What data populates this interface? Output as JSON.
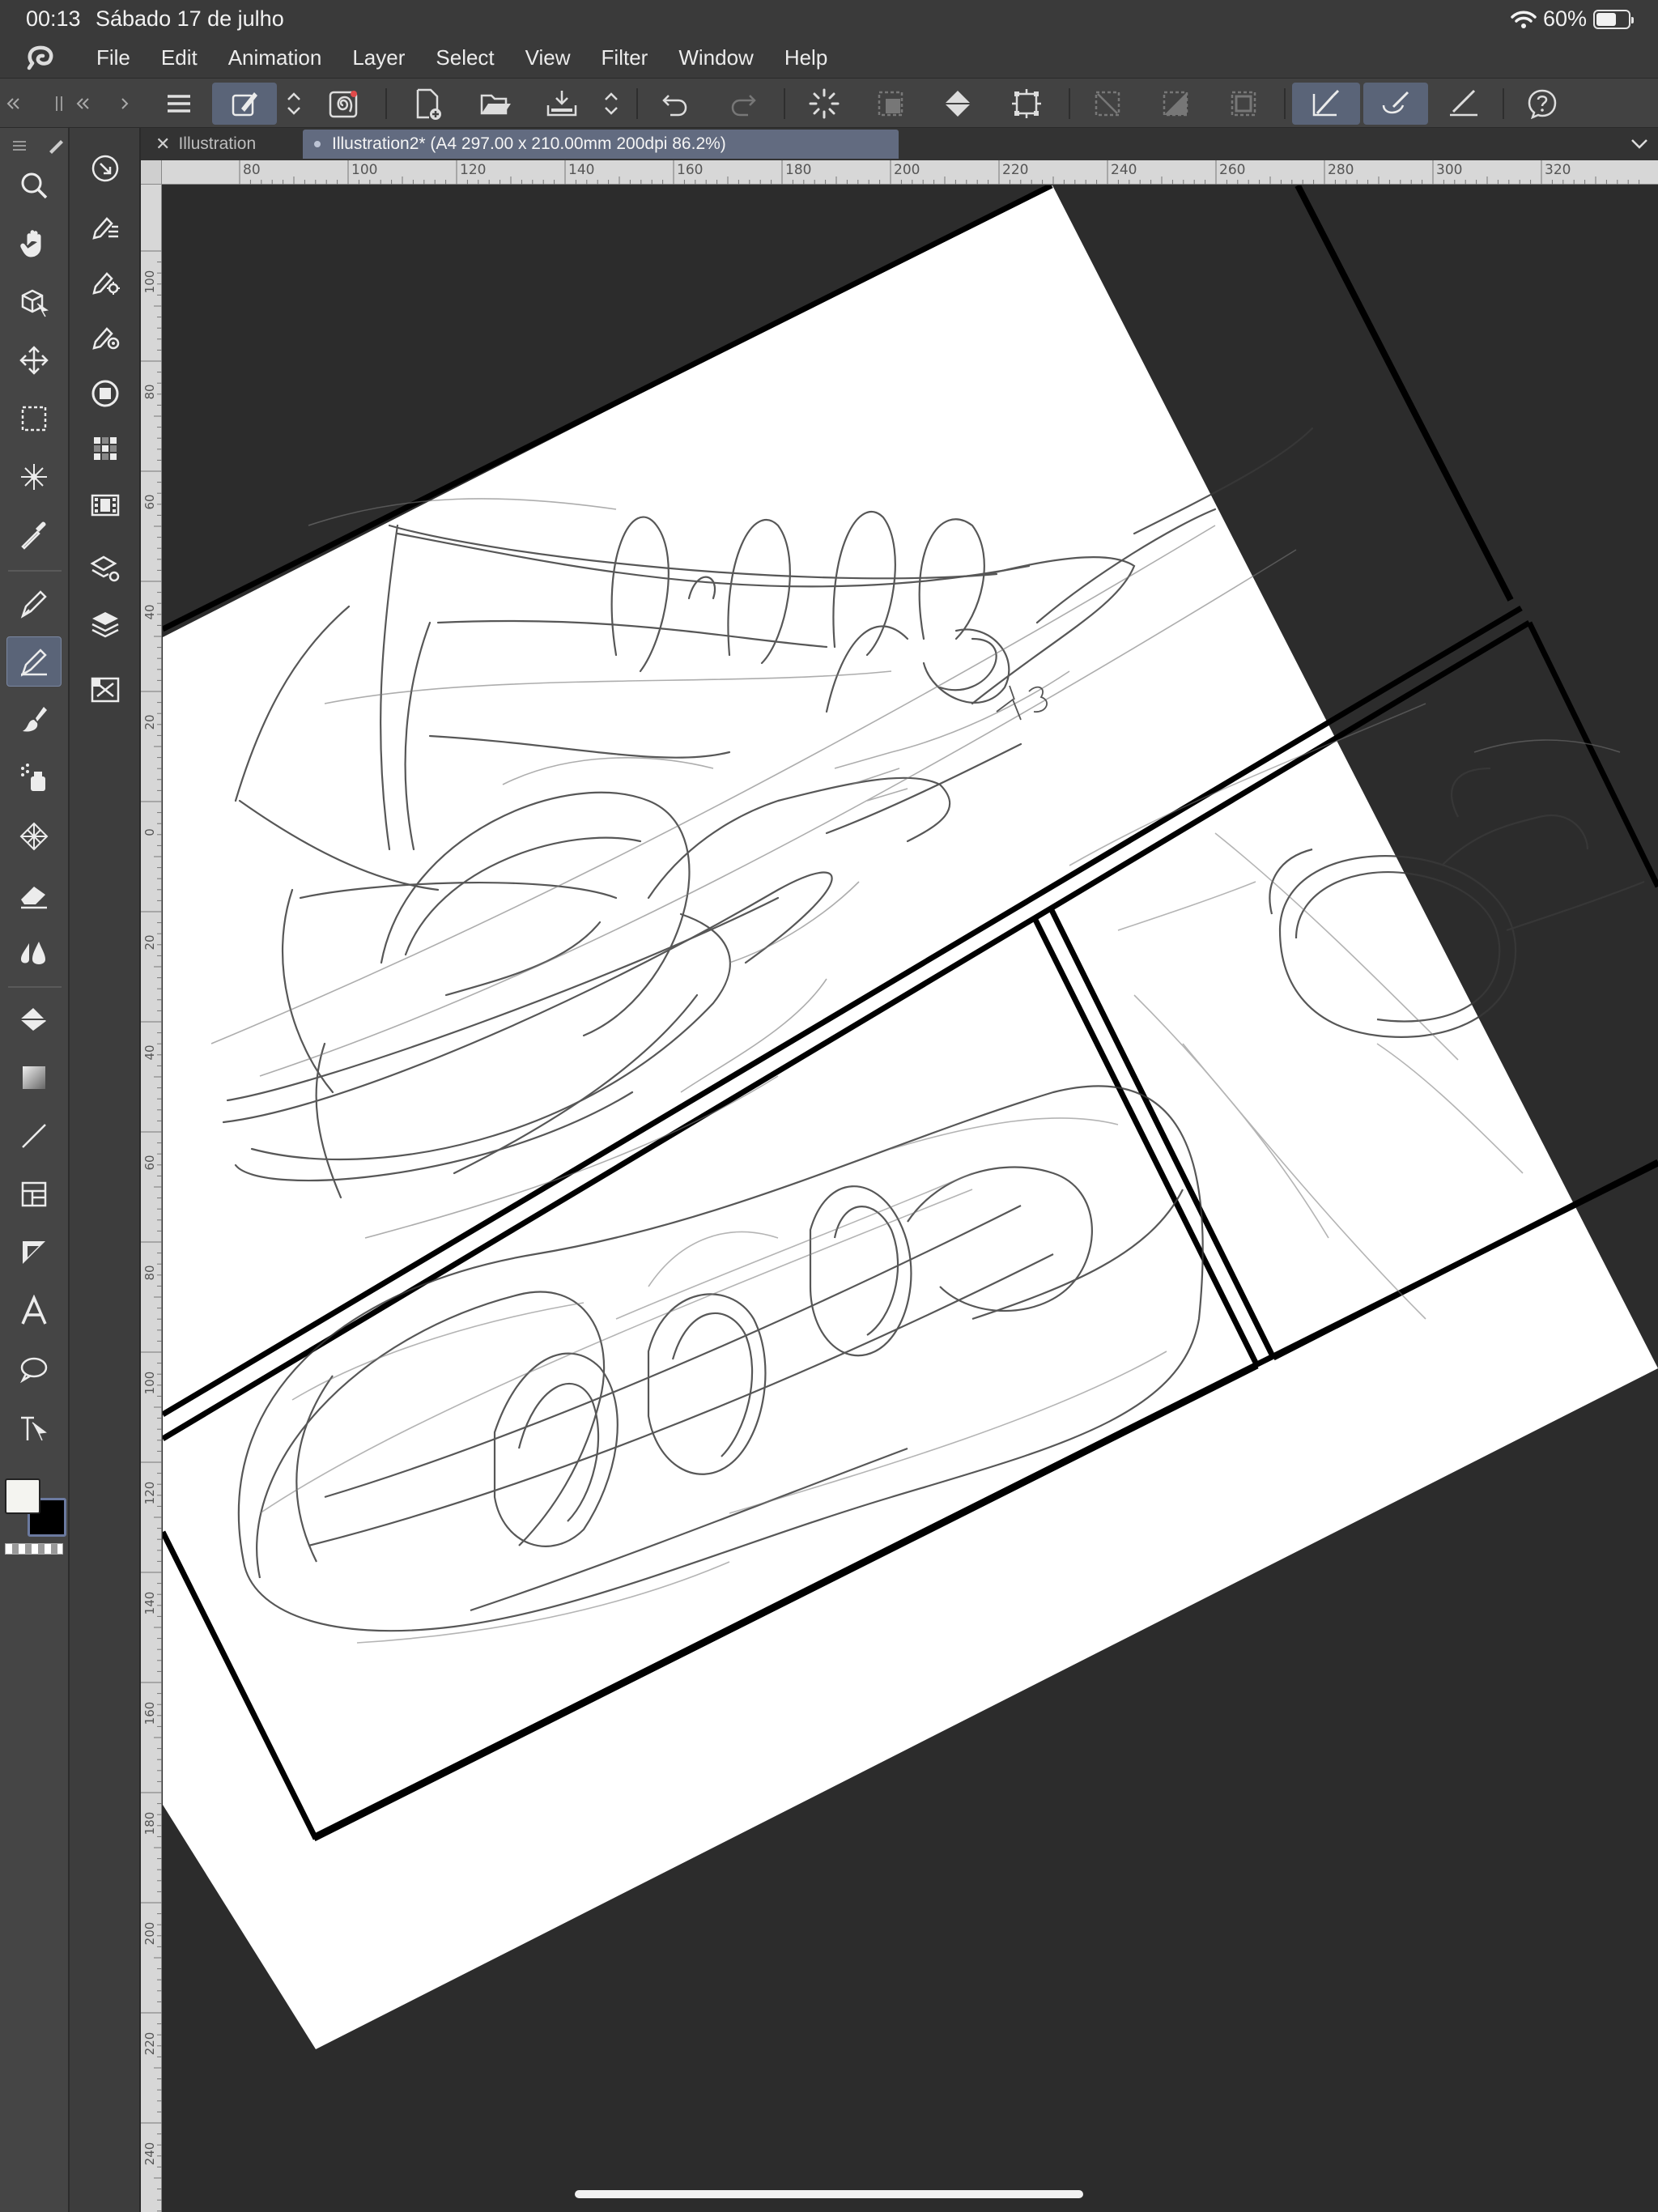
{
  "status_bar": {
    "time": "00:13",
    "date": "Sábado 17 de julho",
    "battery": "60%",
    "battery_level": 0.6
  },
  "menu": {
    "items": [
      "File",
      "Edit",
      "Animation",
      "Layer",
      "Select",
      "View",
      "Filter",
      "Window",
      "Help"
    ]
  },
  "tabs": [
    {
      "label": "Illustration",
      "active": false
    },
    {
      "label": "Illustration2* (A4 297.00 x 210.00mm 200dpi 86.2%)",
      "active": true
    }
  ],
  "ruler_top": [
    "80",
    "100",
    "120",
    "140",
    "160",
    "180",
    "200",
    "220",
    "240",
    "260",
    "280",
    "300",
    "320"
  ],
  "ruler_left": [
    "100",
    "80",
    "60",
    "40",
    "20",
    "0",
    "20",
    "40",
    "60",
    "80",
    "100",
    "120",
    "140",
    "160",
    "180",
    "200",
    "220",
    "240"
  ],
  "colors": {
    "foreground": "#f4f4f0",
    "background": "#000000",
    "accent": "#5a6478",
    "canvas_bg": "#2c2c2c"
  },
  "icons": {
    "command_bar": [
      "menu-icon",
      "brush-tool-icon",
      "stepper-icon",
      "spiral-icon",
      "new-file-icon",
      "open-folder-icon",
      "save-icon",
      "stepper-icon",
      "undo-icon",
      "redo-icon",
      "loading-icon",
      "select-icon",
      "fill-icon",
      "transform-icon",
      "clear-selection-icon",
      "invert-icon",
      "border-icon",
      "pen-pressure-icon",
      "stroke-smooth-icon",
      "ruler-snap-icon",
      "help-icon"
    ],
    "tools": [
      "zoom-icon",
      "hand-icon",
      "object-icon",
      "move-icon",
      "selection-icon",
      "magic-wand-icon",
      "eyedropper-icon",
      "pen-icon",
      "pencil-icon",
      "brush-icon",
      "airbrush-icon",
      "decoration-icon",
      "eraser-icon",
      "blend-icon",
      "fill-icon",
      "gradient-icon",
      "figure-icon",
      "frame-icon",
      "balloon-icon",
      "text-icon",
      "speech-bubble-icon",
      "correct-line-icon"
    ]
  }
}
